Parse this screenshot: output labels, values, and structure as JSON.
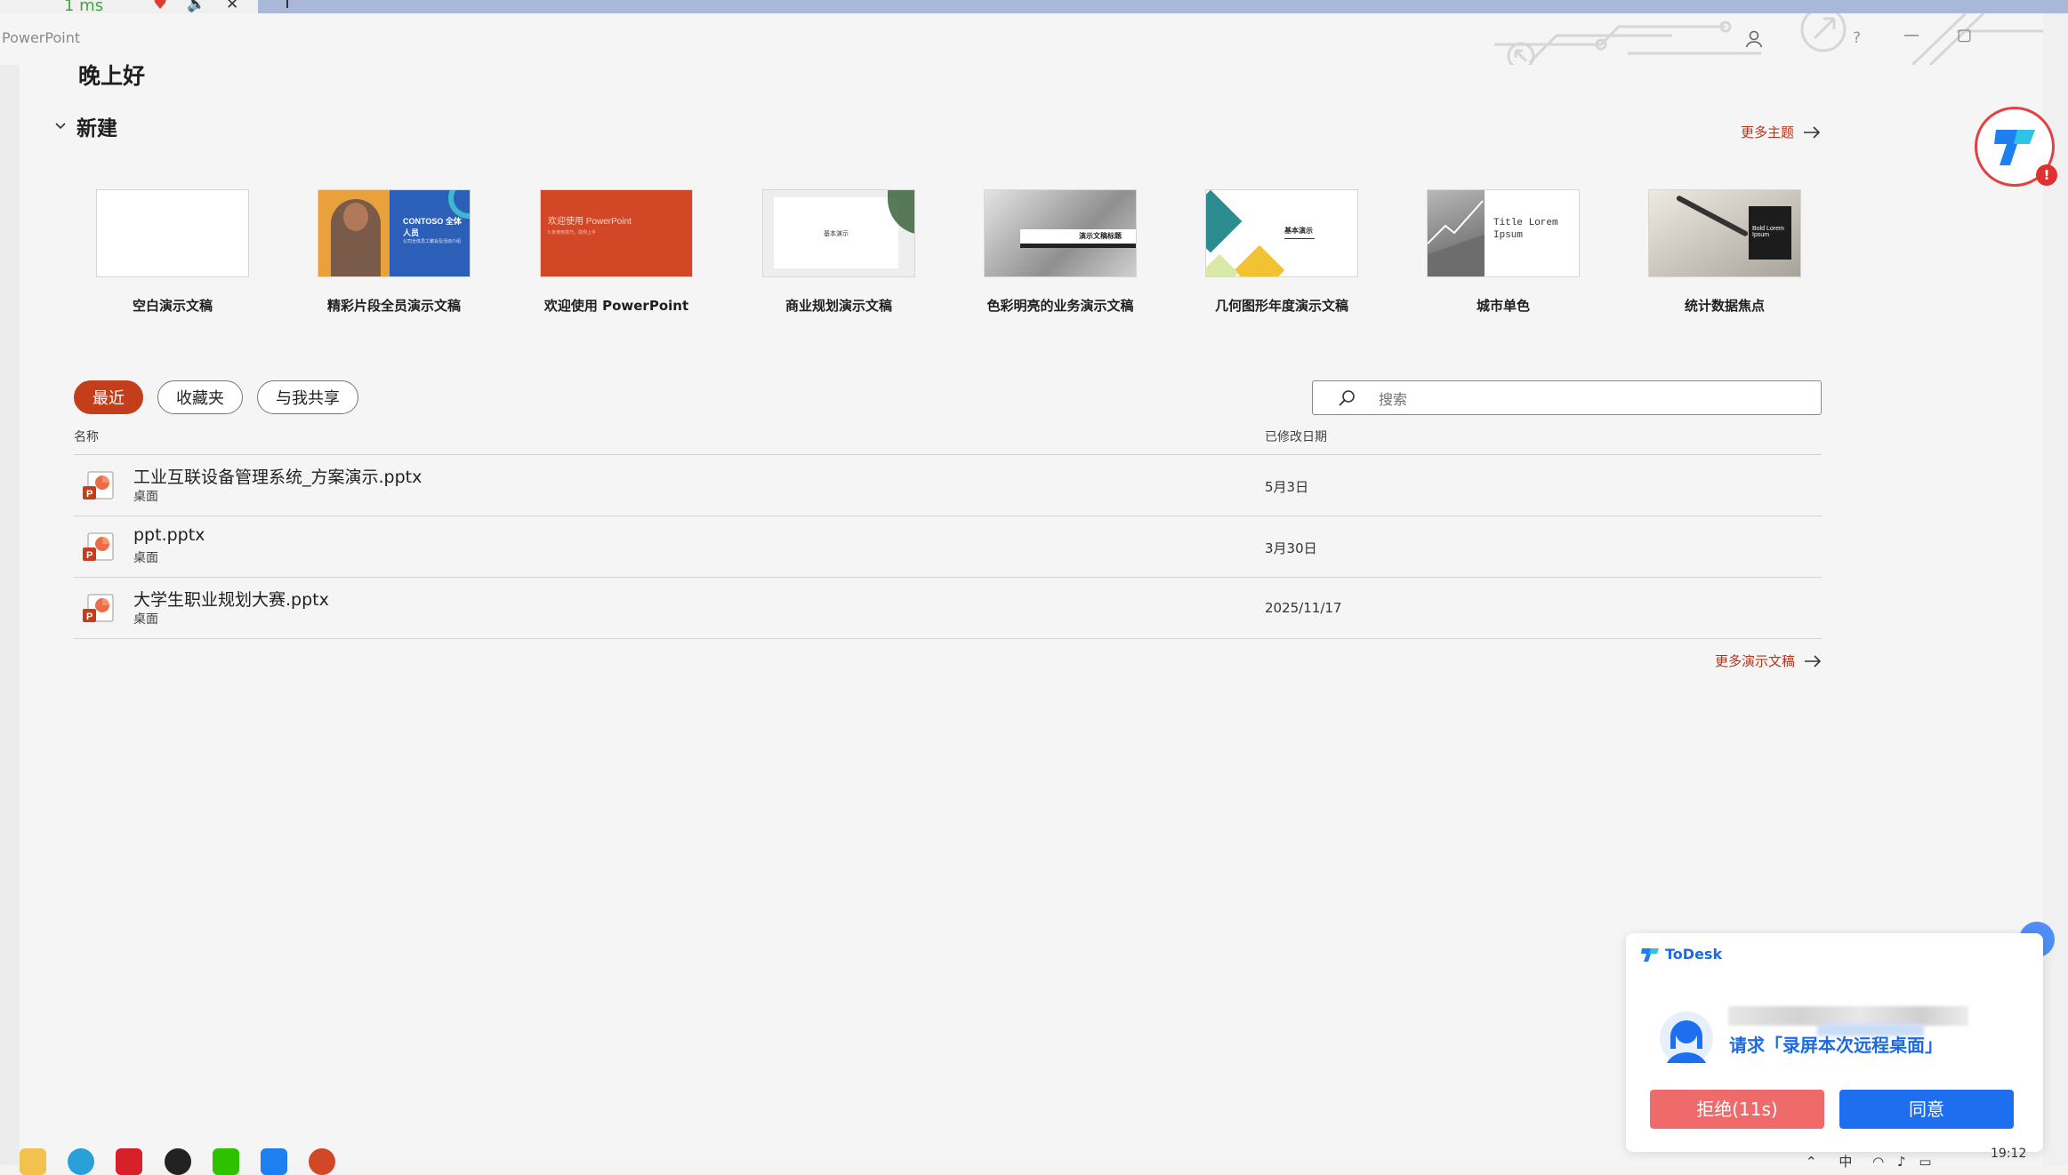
{
  "titlebar": {
    "app_name": "PowerPoint",
    "help": "?",
    "minimize": "—",
    "restore": "▢"
  },
  "greeting": "晚上好",
  "new_section": {
    "title": "新建",
    "more_themes": "更多主题"
  },
  "templates": [
    {
      "name": "空白演示文稿"
    },
    {
      "name": "精彩片段全员演示文稿",
      "thumb_text": "CONTOSO 全体人员",
      "thumb_sub": "公司全体员工聚会及活动介绍"
    },
    {
      "name": "欢迎使用 PowerPoint",
      "thumb_text": "欢迎使用 PowerPoint",
      "thumb_sub": "5 条使用技巧，助你上手"
    },
    {
      "name": "商业规划演示文稿",
      "thumb_text": "基本演示"
    },
    {
      "name": "色彩明亮的业务演示文稿",
      "thumb_text": "演示文稿标题"
    },
    {
      "name": "几何图形年度演示文稿",
      "thumb_text": "基本演示"
    },
    {
      "name": "城市单色",
      "thumb_text": "Title Lorem Ipsum"
    },
    {
      "name": "统计数据焦点",
      "thumb_text": "Bold Lorem Ipsum"
    }
  ],
  "tabs": [
    {
      "label": "最近",
      "active": true
    },
    {
      "label": "收藏夹",
      "active": false
    },
    {
      "label": "与我共享",
      "active": false
    }
  ],
  "search": {
    "placeholder": "搜索"
  },
  "columns": {
    "name": "名称",
    "modified": "已修改日期"
  },
  "files": [
    {
      "name": "工业互联设备管理系统_方案演示.pptx",
      "location": "桌面",
      "date": "5月3日"
    },
    {
      "name": "ppt.pptx",
      "location": "桌面",
      "date": "3月30日"
    },
    {
      "name": "大学生职业规划大赛.pptx",
      "location": "桌面",
      "date": "2025/11/17"
    }
  ],
  "more_docs": "更多演示文稿",
  "todesk": {
    "brand": "ToDesk",
    "request": "请求「录屏本次远程桌面」",
    "reject": "拒绝(11s)",
    "agree": "同意",
    "alert": "!"
  },
  "topbar": {
    "signal": "1 ms"
  },
  "tray": {
    "lang": "中"
  },
  "clock": "19:12",
  "colors": {
    "accent": "#c43e1c",
    "todesk_blue": "#1e6ff0",
    "todesk_red": "#ef6a6a"
  }
}
